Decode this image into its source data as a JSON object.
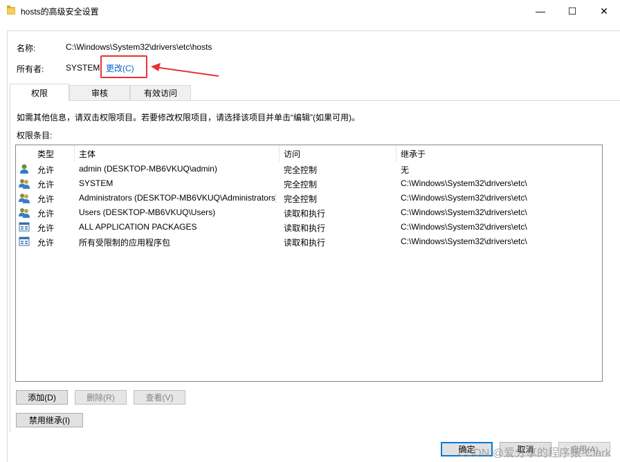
{
  "window": {
    "title": "hosts的高级安全设置",
    "minimize_glyph": "—",
    "maximize_glyph": "☐",
    "close_glyph": "✕"
  },
  "object": {
    "name_label": "名称:",
    "name_value": "C:\\Windows\\System32\\drivers\\etc\\hosts",
    "owner_label": "所有者:",
    "owner_value": "SYSTEM",
    "change_link": "更改(C)"
  },
  "tabs": [
    {
      "label": "权限",
      "active": true
    },
    {
      "label": "审核",
      "active": false
    },
    {
      "label": "有效访问",
      "active": false
    }
  ],
  "info_text": "如需其他信息，请双击权限项目。若要修改权限项目，请选择该项目并单击“编辑”(如果可用)。",
  "entries_label": "权限条目:",
  "table": {
    "columns": [
      "类型",
      "主体",
      "访问",
      "继承于"
    ],
    "rows": [
      {
        "icon": "user-icon",
        "type": "允许",
        "principal": "admin (DESKTOP-MB6VKUQ\\admin)",
        "access": "完全控制",
        "inherited": "无"
      },
      {
        "icon": "group-icon",
        "type": "允许",
        "principal": "SYSTEM",
        "access": "完全控制",
        "inherited": "C:\\Windows\\System32\\drivers\\etc\\"
      },
      {
        "icon": "group-icon",
        "type": "允许",
        "principal": "Administrators (DESKTOP-MB6VKUQ\\Administrators)",
        "access": "完全控制",
        "inherited": "C:\\Windows\\System32\\drivers\\etc\\"
      },
      {
        "icon": "group-icon",
        "type": "允许",
        "principal": "Users (DESKTOP-MB6VKUQ\\Users)",
        "access": "读取和执行",
        "inherited": "C:\\Windows\\System32\\drivers\\etc\\"
      },
      {
        "icon": "app-package-icon",
        "type": "允许",
        "principal": "ALL APPLICATION PACKAGES",
        "access": "读取和执行",
        "inherited": "C:\\Windows\\System32\\drivers\\etc\\"
      },
      {
        "icon": "app-package-icon",
        "type": "允许",
        "principal": "所有受限制的应用程序包",
        "access": "读取和执行",
        "inherited": "C:\\Windows\\System32\\drivers\\etc\\"
      }
    ]
  },
  "buttons": {
    "add": "添加(D)",
    "remove": "删除(R)",
    "view": "查看(V)",
    "disable_inheritance": "禁用继承(I)",
    "ok": "确定",
    "cancel": "取消",
    "apply": "应用(A)"
  },
  "watermark": "CSDN @爱分享的程序猿-Clark",
  "colors": {
    "link": "#0066cc",
    "annotation_red": "#e53333",
    "default_button_border": "#0078d7"
  }
}
